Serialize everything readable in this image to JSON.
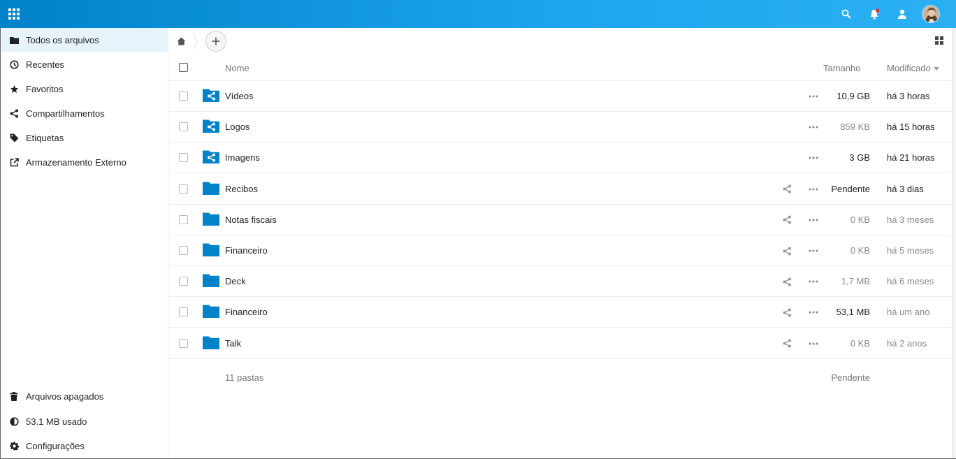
{
  "colors": {
    "header_start": "#0082c9",
    "header_end": "#2bb0f2",
    "accent": "#0082c9",
    "active_nav_bg": "#e6f3fb",
    "notification_dot": "#e9322d"
  },
  "header": {
    "icons": [
      "apps-grid-icon",
      "search-icon",
      "notifications-icon",
      "contacts-icon",
      "avatar"
    ]
  },
  "sidebar": {
    "items": [
      {
        "label": "Todos os arquivos",
        "icon": "folder-icon"
      },
      {
        "label": "Recentes",
        "icon": "clock-icon"
      },
      {
        "label": "Favoritos",
        "icon": "star-icon"
      },
      {
        "label": "Compartilhamentos",
        "icon": "share-icon"
      },
      {
        "label": "Etiquetas",
        "icon": "tag-icon"
      },
      {
        "label": "Armazenamento Externo",
        "icon": "external-link-icon"
      }
    ],
    "bottom": [
      {
        "label": "Arquivos apagados",
        "icon": "trash-icon"
      },
      {
        "label": "53.1 MB usado",
        "icon": "quota-pie-icon"
      },
      {
        "label": "Configurações",
        "icon": "gear-icon"
      }
    ]
  },
  "table": {
    "headers": {
      "name": "Nome",
      "size": "Tamanho",
      "modified": "Modificado"
    },
    "rows": [
      {
        "name": "Vídeos",
        "size": "10,9 GB",
        "modified": "há 3 horas",
        "type": "shared-folder",
        "size_color": "#222222",
        "mod_color": "#222222"
      },
      {
        "name": "Logos",
        "size": "859 KB",
        "modified": "há 15 horas",
        "type": "shared-folder",
        "size_color": "#8a8a8a",
        "mod_color": "#222222"
      },
      {
        "name": "Imagens",
        "size": "3 GB",
        "modified": "há 21 horas",
        "type": "shared-folder",
        "size_color": "#222222",
        "mod_color": "#222222"
      },
      {
        "name": "Recibos",
        "size": "Pendente",
        "modified": "há 3 dias",
        "type": "folder",
        "size_color": "#222222",
        "mod_color": "#222222"
      },
      {
        "name": "Notas fiscais",
        "size": "0 KB",
        "modified": "há 3 meses",
        "type": "folder",
        "size_color": "#8a8a8a",
        "mod_color": "#8a8a8a"
      },
      {
        "name": "Financeiro",
        "size": "0 KB",
        "modified": "há 5 meses",
        "type": "folder",
        "size_color": "#8a8a8a",
        "mod_color": "#8a8a8a"
      },
      {
        "name": "Deck",
        "size": "1,7 MB",
        "modified": "há 6 meses",
        "type": "folder",
        "size_color": "#8a8a8a",
        "mod_color": "#8a8a8a"
      },
      {
        "name": "Financeiro",
        "size": "53,1 MB",
        "modified": "há um ano",
        "type": "folder",
        "size_color": "#222222",
        "mod_color": "#8a8a8a"
      },
      {
        "name": "Talk",
        "size": "0 KB",
        "modified": "há 2 anos",
        "type": "folder",
        "size_color": "#8a8a8a",
        "mod_color": "#8a8a8a"
      }
    ],
    "summary": {
      "count": "11 pastas",
      "total": "Pendente"
    }
  }
}
